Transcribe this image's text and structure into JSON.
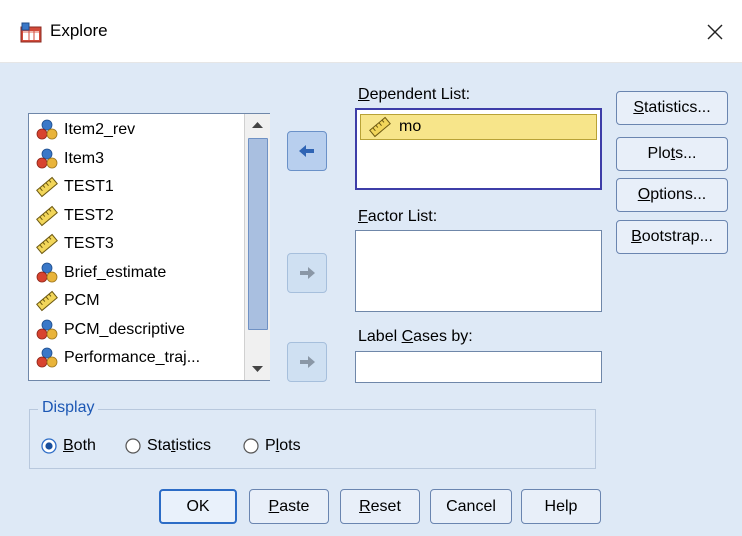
{
  "window": {
    "title": "Explore",
    "close_symbol": "✕"
  },
  "variables": [
    {
      "label": "Item2_rev",
      "type": "nominal"
    },
    {
      "label": "Item3",
      "type": "nominal"
    },
    {
      "label": "TEST1",
      "type": "scale"
    },
    {
      "label": "TEST2",
      "type": "scale"
    },
    {
      "label": "TEST3",
      "type": "scale"
    },
    {
      "label": "Brief_estimate",
      "type": "nominal"
    },
    {
      "label": "PCM",
      "type": "scale"
    },
    {
      "label": "PCM_descriptive",
      "type": "nominal"
    },
    {
      "label": "Performance_traj...",
      "type": "nominal"
    }
  ],
  "dependent_list": {
    "label_u": "D",
    "label_rest": "ependent List:",
    "items": [
      {
        "label": "mo",
        "type": "scale"
      }
    ]
  },
  "factor_list": {
    "label_u": "F",
    "label_rest": "actor List:"
  },
  "label_cases": {
    "label_pre": "Label ",
    "label_u": "C",
    "label_post": "ases by:"
  },
  "side_buttons": {
    "statistics": {
      "u": "S",
      "rest": "tatistics...",
      "pre": ""
    },
    "plots": {
      "pre": "Plo",
      "u": "t",
      "rest": "s..."
    },
    "options": {
      "pre": "",
      "u": "O",
      "rest": "ptions..."
    },
    "bootstrap": {
      "pre": "",
      "u": "B",
      "rest": "ootstrap..."
    }
  },
  "display": {
    "legend": "Display",
    "options": [
      {
        "pre": "",
        "u": "B",
        "post": "oth",
        "selected": true
      },
      {
        "pre": "Sta",
        "u": "t",
        "post": "istics",
        "selected": false
      },
      {
        "pre": "P",
        "u": "l",
        "post": "ots",
        "selected": false
      }
    ]
  },
  "bottom_buttons": {
    "ok": "OK",
    "paste": {
      "u": "P",
      "rest": "aste"
    },
    "reset": {
      "u": "R",
      "rest": "eset"
    },
    "cancel": "Cancel",
    "help": "Help"
  },
  "colors": {
    "dialog_bg": "#dee9f6",
    "selected_item": "#f7e58a",
    "focus_border": "#3d3da8",
    "legend_text": "#1c57b4"
  },
  "icons": {
    "nominal": "nominal-variable-icon",
    "scale": "scale-ruler-icon",
    "app": "explore-app-icon"
  }
}
